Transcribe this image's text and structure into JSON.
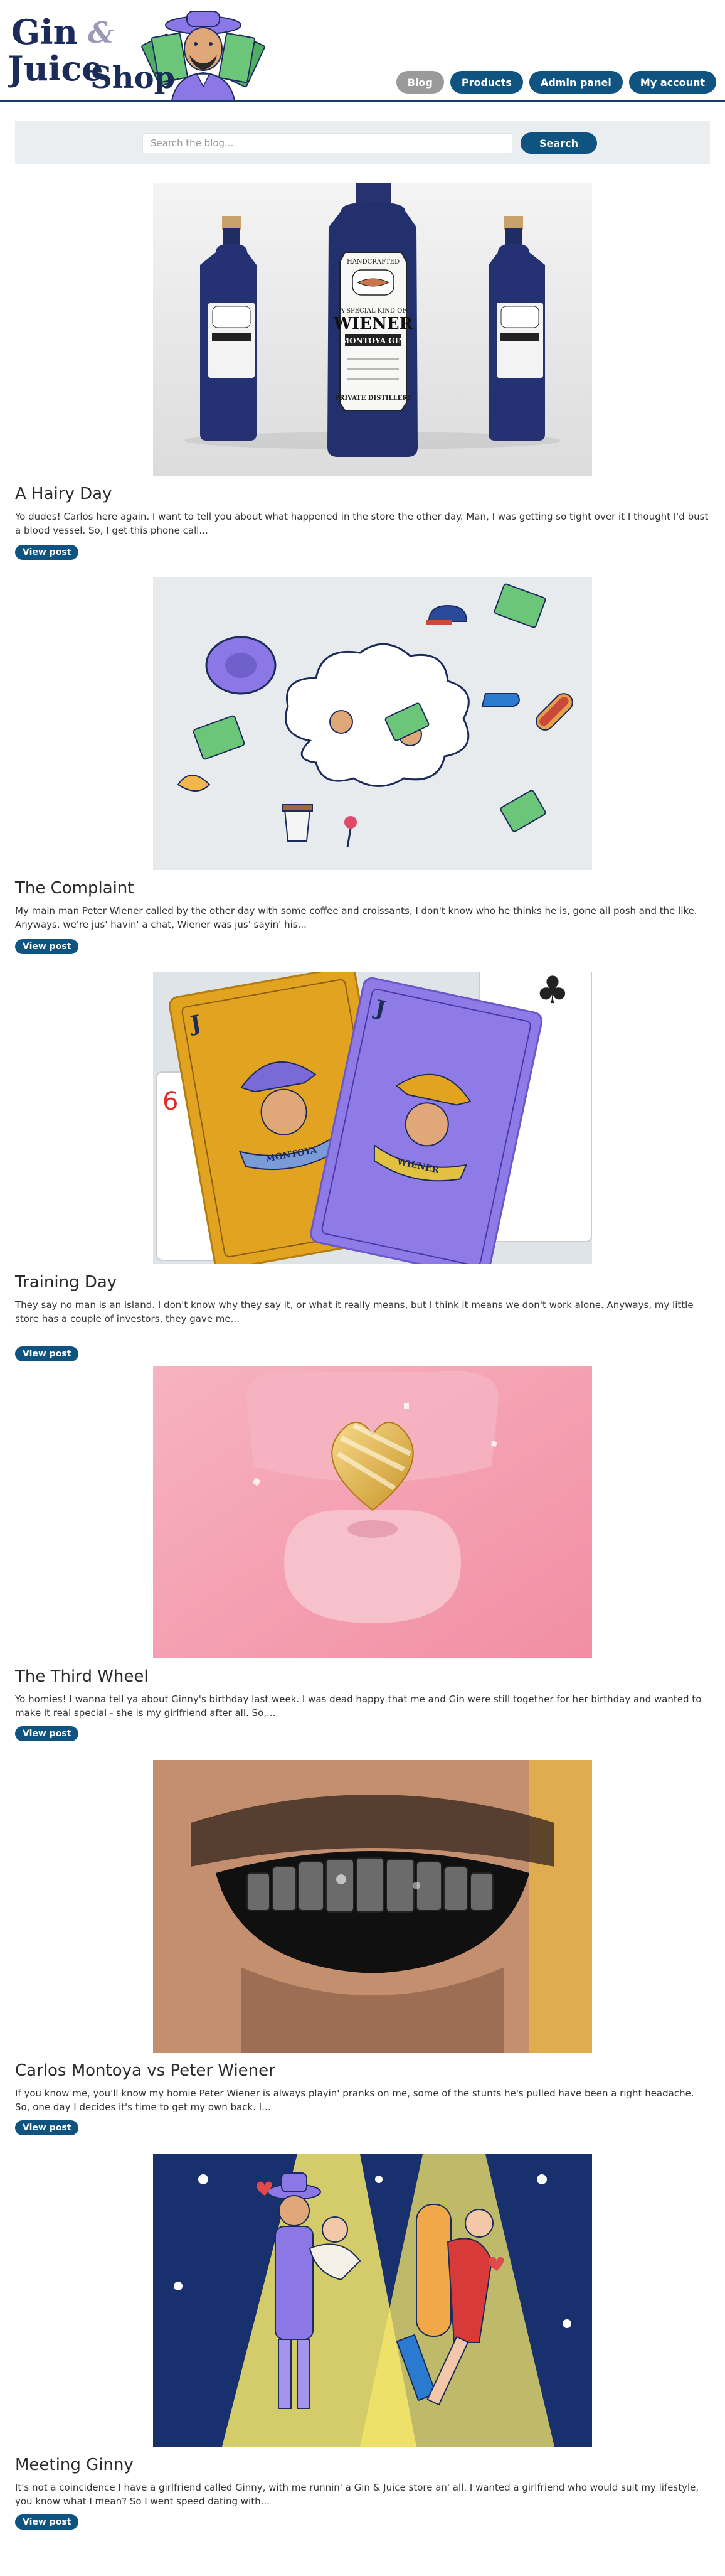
{
  "site": {
    "logo_line1": "Gin",
    "logo_amp": "&",
    "logo_line2": "Juice",
    "logo_line3": "Shop"
  },
  "nav": [
    {
      "label": "Blog"
    },
    {
      "label": "Products"
    },
    {
      "label": "Admin panel"
    },
    {
      "label": "My account"
    }
  ],
  "search": {
    "placeholder": "Search the blog...",
    "button_label": "Search"
  },
  "posts": [
    {
      "title": "A Hairy Day",
      "summary": "Yo dudes! Carlos here again. I want to tell you about what happened in the store the other day. Man, I was getting so tight over it I thought I'd bust a blood vessel. So, I get this phone call...",
      "button": "View post",
      "label_top": "HANDCRAFTED",
      "label_mid": "A SPECIAL KIND OF",
      "label_big": "WIENER",
      "label_brand": "MONTOYA GIN",
      "label_bottom": "PRIVATE DISTILLERY"
    },
    {
      "title": "The Complaint",
      "summary": "My main man Peter Wiener called by the other day with some coffee and croissants, I don't know who he thinks he is, gone all posh and the like. Anyways, we're jus' havin' a chat, Wiener was jus' sayin' his...",
      "button": "View post"
    },
    {
      "title": "Training Day",
      "summary": "They say no man is an island. I don't know why they say it, or what it really means, but I think it means we don't work alone. Anyways, my little store has a couple of investors, they gave me...",
      "button": "View post",
      "card1_banner": "MONTOYA",
      "card2_banner": "WIENER"
    },
    {
      "title": "The Third Wheel",
      "summary": "Yo homies! I wanna tell ya about Ginny's birthday last week. I was dead happy that me and Gin were still together for her birthday and wanted to make it real special - she is my girlfriend after all. So,...",
      "button": "View post"
    },
    {
      "title": "Carlos Montoya vs Peter Wiener",
      "summary": "If you know me, you'll know my homie Peter Wiener is always playin' pranks on me, some of the stunts he's pulled have been a right headache. So, one day I decides it's time to get my own back. I...",
      "button": "View post"
    },
    {
      "title": "Meeting Ginny",
      "summary": "It's not a coincidence I have a girlfriend called Ginny, with me runnin' a Gin & Juice store an' all. I wanted a girlfriend who would suit my lifestyle, you know what I mean? So I went speed dating with...",
      "button": "View post"
    }
  ]
}
